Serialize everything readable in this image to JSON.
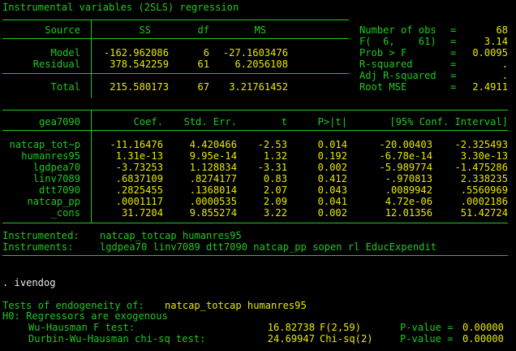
{
  "title": "Instrumental variables (2SLS) regression",
  "anova": {
    "headers": [
      "Source",
      "SS",
      "df",
      "MS"
    ],
    "rows": [
      {
        "source": "Model",
        "ss": "-162.962086",
        "df": "6",
        "ms": "-27.1603476"
      },
      {
        "source": "Residual",
        "ss": "378.542259",
        "df": "61",
        "ms": "6.2056108"
      }
    ],
    "total": {
      "source": "Total",
      "ss": "215.580173",
      "df": "67",
      "ms": "3.21761452"
    }
  },
  "stats": [
    {
      "label": "Number of obs",
      "eq": "=",
      "value": "68"
    },
    {
      "label": "F(  6,    61)",
      "eq": "=",
      "value": "3.14"
    },
    {
      "label": "Prob > F",
      "eq": "=",
      "value": "0.0095"
    },
    {
      "label": "R-squared",
      "eq": "=",
      "value": "."
    },
    {
      "label": "Adj R-squared",
      "eq": "=",
      "value": "."
    },
    {
      "label": "Root MSE",
      "eq": "=",
      "value": "2.4911"
    }
  ],
  "coef": {
    "headers": [
      "gea7090",
      "Coef.",
      "Std. Err.",
      "t",
      "P>|t|",
      "[95% Conf. Interval]"
    ],
    "rows": [
      {
        "name": "natcap_tot~p",
        "coef": "-11.16476",
        "se": "4.420466",
        "t": "-2.53",
        "p": "0.014",
        "lo": "-20.00403",
        "hi": "-2.325493"
      },
      {
        "name": "humanres95",
        "coef": "1.31e-13",
        "se": "9.95e-14",
        "t": "1.32",
        "p": "0.192",
        "lo": "-6.78e-14",
        "hi": "3.30e-13"
      },
      {
        "name": "lgdpea70",
        "coef": "-3.73253",
        "se": "1.128834",
        "t": "-3.31",
        "p": "0.002",
        "lo": "-5.989774",
        "hi": "-1.475286"
      },
      {
        "name": "linv7089",
        "coef": ".6837109",
        "se": ".8274177",
        "t": "0.83",
        "p": "0.412",
        "lo": "-.970813",
        "hi": "2.338235"
      },
      {
        "name": "dtt7090",
        "coef": ".2825455",
        "se": ".1368014",
        "t": "2.07",
        "p": "0.043",
        "lo": ".0089942",
        "hi": ".5560969"
      },
      {
        "name": "natcap_pp",
        "coef": ".0001117",
        "se": ".0000535",
        "t": "2.09",
        "p": "0.041",
        "lo": "4.72e-06",
        "hi": ".0002186"
      },
      {
        "name": "_cons",
        "coef": "31.7204",
        "se": "9.855274",
        "t": "3.22",
        "p": "0.002",
        "lo": "12.01356",
        "hi": "51.42724"
      }
    ]
  },
  "instrumented_label": "Instrumented:",
  "instrumented_value": "natcap_totcap humanres95",
  "instruments_label": "Instruments:",
  "instruments_value": "lgdpea70 linv7089 dtt7090 natcap_pp sopen rl EducExpendit",
  "command": ". ivendog",
  "endog_label": "Tests of endogeneity of:",
  "endog_vars": "natcap_totcap humanres95",
  "h0": "H0: Regressors are exogenous",
  "tests": [
    {
      "name": "Wu-Hausman F test:",
      "stat": "16.82738",
      "dist": "F(2,59)",
      "plabel": "P-value =",
      "pval": "0.00000"
    },
    {
      "name": "Durbin-Wu-Hausman chi-sq test:",
      "stat": "24.69947",
      "dist": "Chi-sq(2)",
      "plabel": "P-value =",
      "pval": "0.00000"
    }
  ],
  "colors": {
    "background": "#000000",
    "text": "#20c820",
    "result": "#e8e800",
    "input": "#e8e8e8"
  }
}
